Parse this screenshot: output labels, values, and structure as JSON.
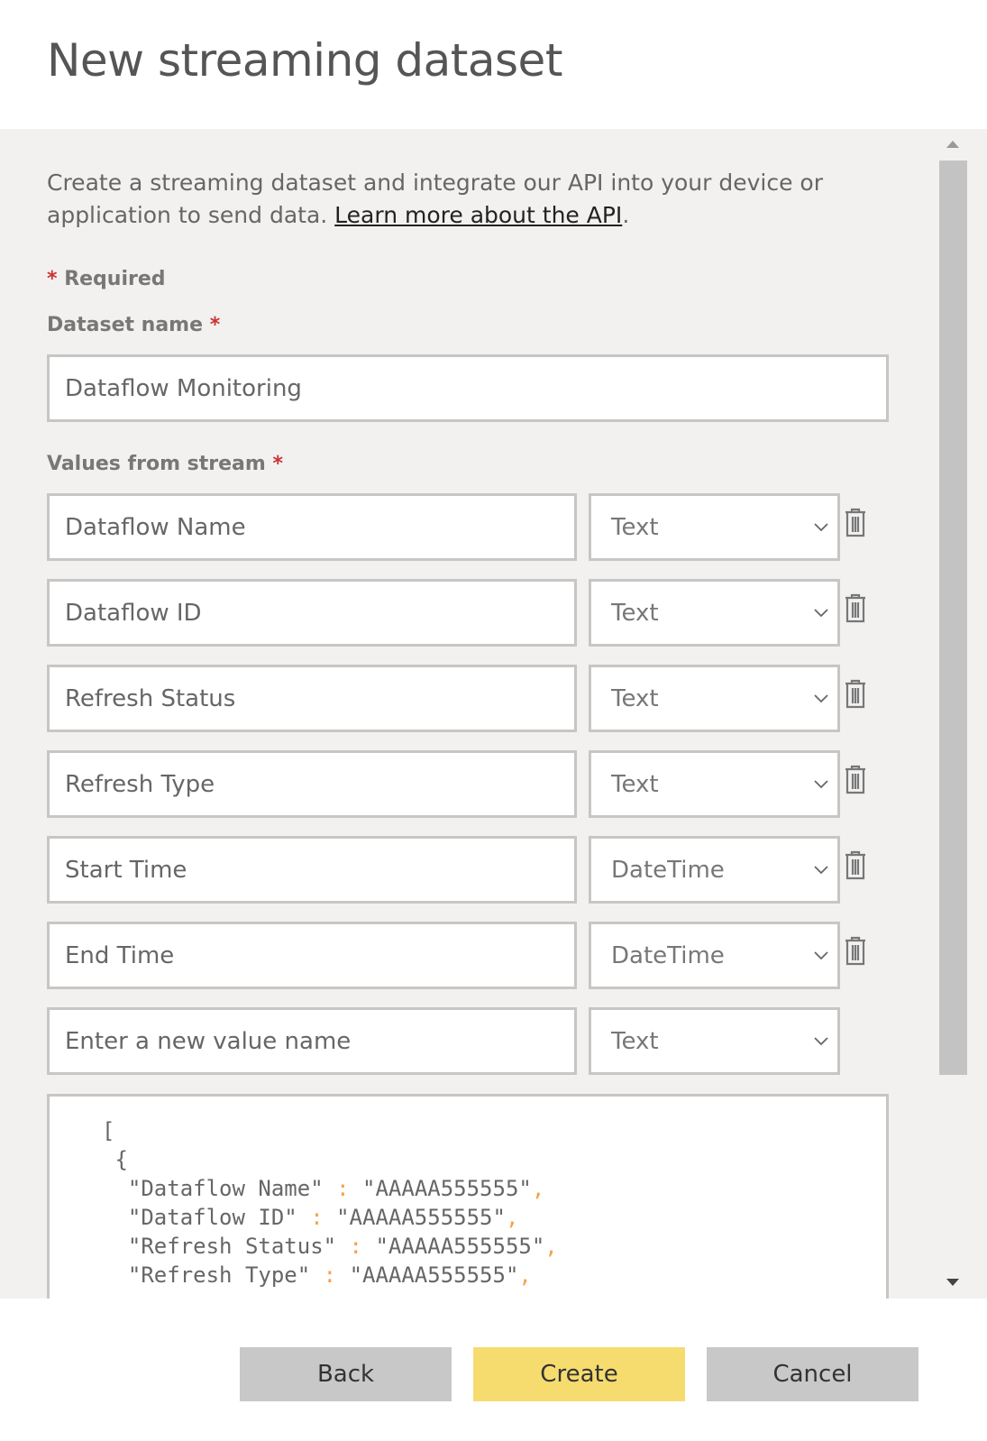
{
  "title": "New streaming dataset",
  "description": {
    "text": "Create a streaming dataset and integrate our API into your device or application to send data. ",
    "link": "Learn more about the API",
    "end": "."
  },
  "required_note": "Required",
  "required_mark": "*",
  "dataset_name": {
    "label": "Dataset name",
    "value": "Dataflow Monitoring"
  },
  "values_label": "Values from stream",
  "values": [
    {
      "name": "Dataflow Name",
      "type": "Text"
    },
    {
      "name": "Dataflow ID",
      "type": "Text"
    },
    {
      "name": "Refresh Status",
      "type": "Text"
    },
    {
      "name": "Refresh Type",
      "type": "Text"
    },
    {
      "name": "Start Time",
      "type": "DateTime"
    },
    {
      "name": "End Time",
      "type": "DateTime"
    }
  ],
  "new_value": {
    "placeholder": "Enter a new value name",
    "type": "Text"
  },
  "code": {
    "open_bracket": "[",
    "open_brace": " {",
    "lines": [
      {
        "key": "\"Dataflow Name\"",
        "value": "\"AAAAA555555\""
      },
      {
        "key": "\"Dataflow ID\"",
        "value": "\"AAAAA555555\""
      },
      {
        "key": "\"Refresh Status\"",
        "value": "\"AAAAA555555\""
      },
      {
        "key": "\"Refresh Type\"",
        "value": "\"AAAAA555555\""
      }
    ]
  },
  "buttons": {
    "back": "Back",
    "create": "Create",
    "cancel": "Cancel"
  },
  "colors": {
    "primary_button": "#f6dc6f",
    "secondary_button": "#c8c8c8",
    "json_punct": "#f7a14b",
    "required": "#cc3333"
  },
  "icons": {
    "delete": "trash-icon",
    "dropdown": "chevron-down-icon"
  }
}
